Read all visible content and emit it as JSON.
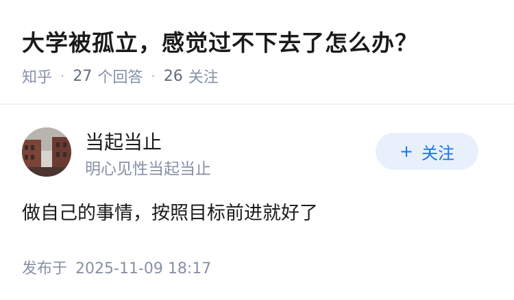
{
  "question": {
    "title": "大学被孤立，感觉过不下去了怎么办？",
    "source": "知乎",
    "answers_count": "27",
    "answers_label": "个回答",
    "followers_count": "26",
    "followers_label": "关注"
  },
  "author": {
    "name": "当起当止",
    "bio": "明心见性当起当止",
    "avatar": "building-photo-avatar",
    "follow_label": "关注",
    "follow_icon": "plus-icon"
  },
  "answer": {
    "text": "做自己的事情，按照目标前进就好了",
    "published_label": "发布于",
    "published_time": "2025-11-09 18:17"
  },
  "colors": {
    "accent": "#1772f6",
    "follow_bg": "#e8f0fb",
    "muted_text": "#8590a6",
    "primary_text": "#1a1a1a"
  }
}
